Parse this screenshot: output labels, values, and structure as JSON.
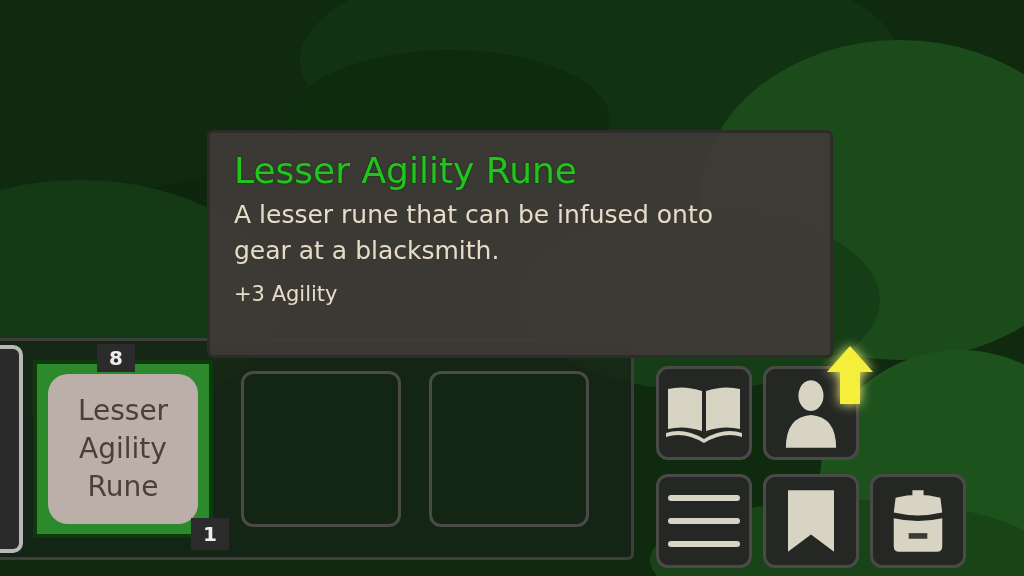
{
  "tooltip": {
    "title": "Lesser Agility Rune",
    "description": "A lesser rune that can be infused onto gear at a blacksmith.",
    "stat": "+3 Agility"
  },
  "hotbar": {
    "slots": [
      {
        "kind": "partial"
      },
      {
        "kind": "item",
        "name": "Lesser Agility Rune",
        "key": "8",
        "count": "1",
        "selected": true
      },
      {
        "kind": "empty"
      },
      {
        "kind": "empty"
      }
    ]
  },
  "menu_buttons": [
    {
      "kind": "book",
      "notification": false
    },
    {
      "kind": "character",
      "notification": true
    },
    {
      "kind": "menu",
      "notification": false
    },
    {
      "kind": "bookmark",
      "notification": false
    },
    {
      "kind": "backpack",
      "notification": false
    }
  ]
}
